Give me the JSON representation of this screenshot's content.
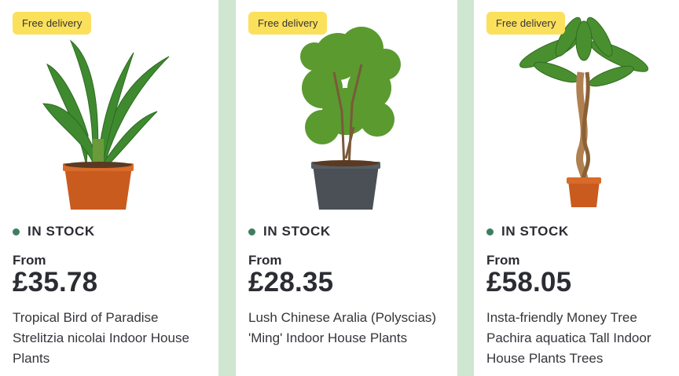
{
  "products": [
    {
      "badge": "Free delivery",
      "stock": "IN STOCK",
      "from": "From",
      "price": "£35.78",
      "title": "Tropical Bird of Paradise Strelitzia nicolai Indoor House Plants",
      "plant": "bird-of-paradise-plant",
      "pot_color": "#c95b1f"
    },
    {
      "badge": "Free delivery",
      "stock": "IN STOCK",
      "from": "From",
      "price": "£28.35",
      "title": "Lush Chinese Aralia (Polyscias) 'Ming' Indoor House Plants",
      "plant": "chinese-aralia-plant",
      "pot_color": "#4a5056"
    },
    {
      "badge": "Free delivery",
      "stock": "IN STOCK",
      "from": "From",
      "price": "£58.05",
      "title": "Insta-friendly Money Tree Pachira aquatica Tall Indoor House Plants Trees",
      "plant": "money-tree-plant",
      "pot_color": "#c95b1f"
    }
  ],
  "colors": {
    "background": "#cfe6d0",
    "badge": "#fbe05c",
    "stock_dot": "#3e7e62",
    "text": "#2b2d33"
  }
}
